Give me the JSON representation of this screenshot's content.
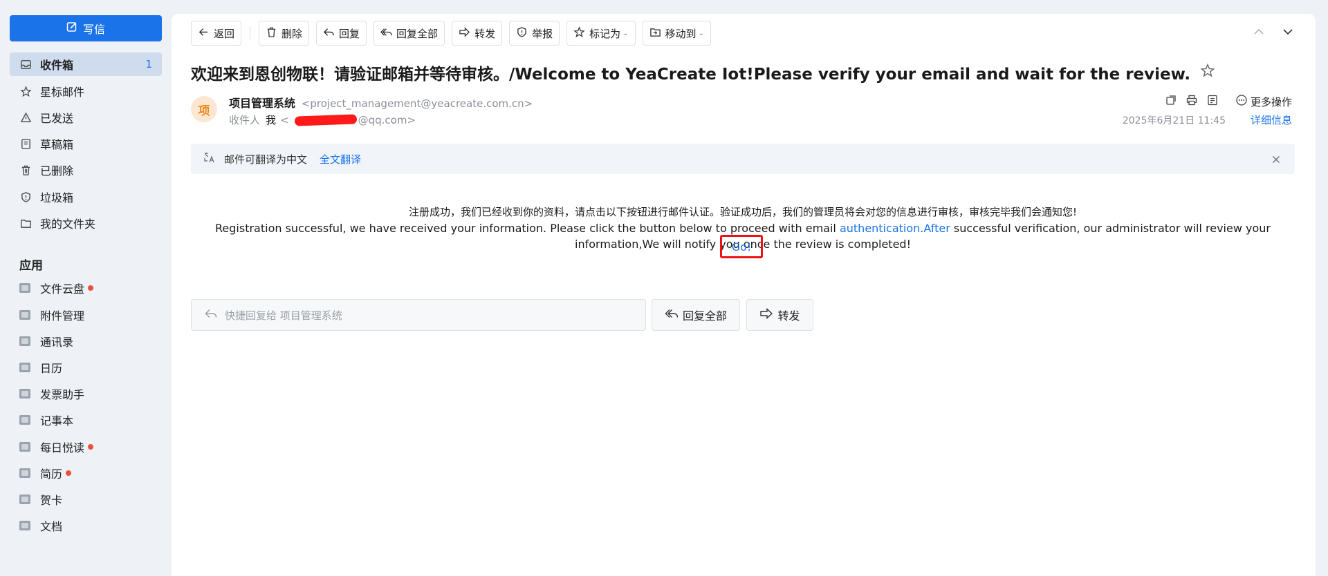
{
  "sidebar": {
    "compose_label": "写信",
    "folders": [
      {
        "label": "收件箱",
        "count": "1"
      },
      {
        "label": "星标邮件"
      },
      {
        "label": "已发送"
      },
      {
        "label": "草稿箱"
      },
      {
        "label": "已删除"
      },
      {
        "label": "垃圾箱"
      },
      {
        "label": "我的文件夹"
      }
    ],
    "apps_title": "应用",
    "apps": [
      {
        "label": "文件云盘",
        "dot": true
      },
      {
        "label": "附件管理"
      },
      {
        "label": "通讯录"
      },
      {
        "label": "日历"
      },
      {
        "label": "发票助手"
      },
      {
        "label": "记事本"
      },
      {
        "label": "每日悦读",
        "dot": true
      },
      {
        "label": "简历",
        "dot": true
      },
      {
        "label": "贺卡"
      },
      {
        "label": "文档"
      }
    ]
  },
  "toolbar": {
    "back": "返回",
    "delete": "删除",
    "reply": "回复",
    "reply_all": "回复全部",
    "forward": "转发",
    "report": "举报",
    "mark_as": "标记为",
    "move_to": "移动到"
  },
  "email": {
    "subject": "欢迎来到恩创物联！请验证邮箱并等待审核。/Welcome to YeaCreate Iot!Please verify your email and wait for the review.",
    "avatar_char": "项",
    "sender_name": "项目管理系统",
    "sender_address": "<project_management@yeacreate.com.cn>",
    "recipient_label": "收件人",
    "recipient_me": "我",
    "recipient_prefix": "<",
    "recipient_suffix": "@qq.com>",
    "more_ops": "更多操作",
    "datetime": "2025年6月21日 11:45",
    "details": "详细信息",
    "translate_notice": "邮件可翻译为中文",
    "translate_action": "全文翻译",
    "body_cn": "注册成功，我们已经收到你的资料，请点击以下按钮进行邮件认证。验证成功后，我们的管理员将会对您的信息进行审核，审核完毕我们会通知您!",
    "body_en_1": "Registration successful, we have received your information. Please click the button below to proceed with email ",
    "body_en_link": "authentication.After",
    "body_en_2": " successful verification, our administrator will review your information,We will notify you once the review is completed!",
    "go_label": "Go!"
  },
  "quick": {
    "reply_placeholder": "快捷回复给 项目管理系统",
    "reply_all": "回复全部",
    "forward": "转发"
  },
  "colors": {
    "accent": "#1a73e8",
    "highlight_box": "#ee1111",
    "notification_dot": "#f04d3a"
  }
}
